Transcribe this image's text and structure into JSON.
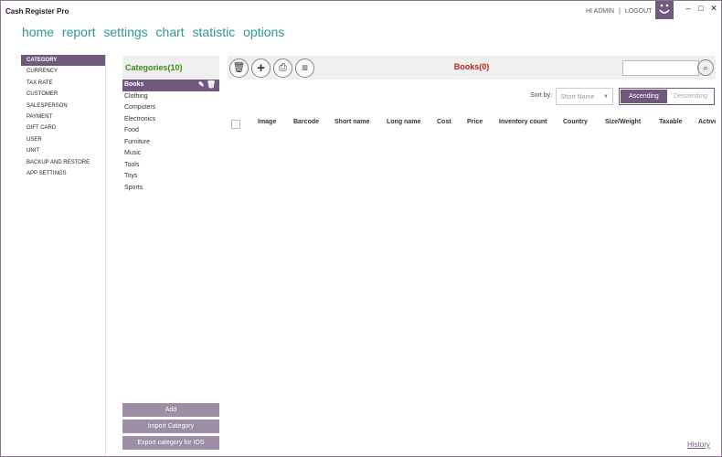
{
  "app": {
    "title": "Cash Register Pro"
  },
  "user": {
    "greeting": "HI ADMIN",
    "separator": "|",
    "logout": "LOGOUT"
  },
  "window": {
    "minimize": "–",
    "maximize": "□",
    "close": "✕"
  },
  "nav": {
    "items": [
      {
        "label": "home"
      },
      {
        "label": "report"
      },
      {
        "label": "settings"
      },
      {
        "label": "chart"
      },
      {
        "label": "statistic"
      },
      {
        "label": "options"
      }
    ]
  },
  "sidebar": {
    "items": [
      {
        "label": "CATEGORY",
        "active": true
      },
      {
        "label": "CURRENCY"
      },
      {
        "label": "TAX RATE"
      },
      {
        "label": "CUSTOMER"
      },
      {
        "label": "SALESPERSON"
      },
      {
        "label": "PAYMENT"
      },
      {
        "label": "GIFT CARD"
      },
      {
        "label": "USER"
      },
      {
        "label": "UNIT"
      },
      {
        "label": "BACKUP AND RESTORE"
      },
      {
        "label": "APP SETTINGS"
      }
    ]
  },
  "categories": {
    "title": "Categories(10)",
    "items": [
      {
        "label": "Books",
        "selected": true
      },
      {
        "label": "Clothing"
      },
      {
        "label": "Computers"
      },
      {
        "label": "Electronics"
      },
      {
        "label": "Food"
      },
      {
        "label": "Furniture"
      },
      {
        "label": "Music"
      },
      {
        "label": "Tools"
      },
      {
        "label": "Toys"
      },
      {
        "label": "Sports"
      }
    ],
    "add_label": "Add",
    "import_label": "Import Category",
    "export_label": "Export category for IOS"
  },
  "products": {
    "title": "Books(0)",
    "search_placeholder": "",
    "sort_label": "Sort by:",
    "sort_value": "Short Name",
    "ascending": "Ascending",
    "descending": "Descending",
    "columns": [
      "Image",
      "Barcode",
      "Short name",
      "Long name",
      "Cost",
      "Price",
      "Inventory count",
      "Country",
      "Size/Weight",
      "Taxable",
      "Active"
    ]
  },
  "footer": {
    "history": "History"
  },
  "colors": {
    "accent": "#6f5a7e",
    "nav": "#2e9a8c",
    "title_red": "#b3262a",
    "title_green": "#3f8a1e"
  }
}
